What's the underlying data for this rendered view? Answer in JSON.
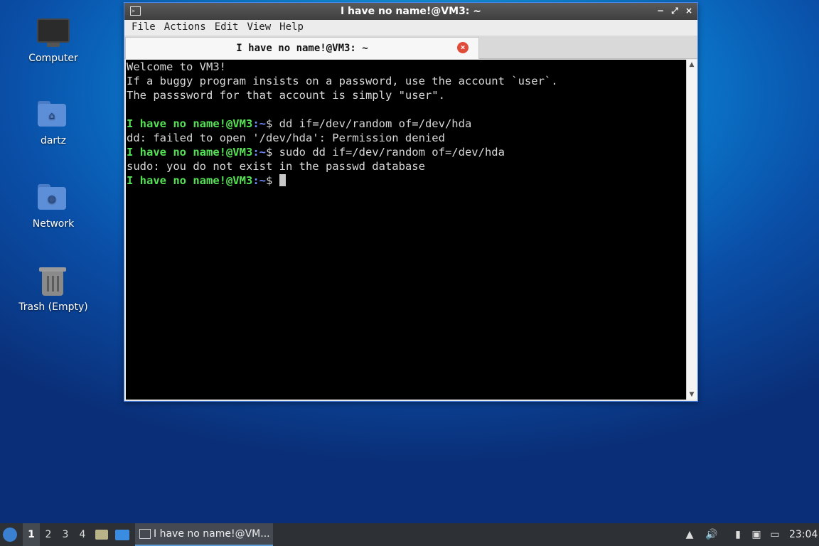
{
  "desktop": {
    "icons": [
      {
        "label": "Computer",
        "icon": "computer-icon"
      },
      {
        "label": "dartz",
        "icon": "home-folder-icon"
      },
      {
        "label": "Network",
        "icon": "network-folder-icon"
      },
      {
        "label": "Trash (Empty)",
        "icon": "trash-icon"
      }
    ]
  },
  "window": {
    "title": "I have no name!@VM3: ~",
    "controls": {
      "minimize": "−",
      "maximize": "⤢",
      "close": "×"
    },
    "menu": [
      "File",
      "Actions",
      "Edit",
      "View",
      "Help"
    ],
    "tab": {
      "label": "I have no name!@VM3: ~",
      "close": "×"
    }
  },
  "terminal": {
    "lines": [
      {
        "text": "Welcome to VM3!"
      },
      {
        "text": "If a buggy program insists on a password, use the account `user`."
      },
      {
        "text": "The passsword for that account is simply \"user\"."
      },
      {
        "text": ""
      },
      {
        "prompt_user": "I have no name!@VM3",
        "prompt_path": ":~",
        "prompt_sym": "$ ",
        "cmd": "dd if=/dev/random of=/dev/hda"
      },
      {
        "text": "dd: failed to open '/dev/hda': Permission denied"
      },
      {
        "prompt_user": "I have no name!@VM3",
        "prompt_path": ":~",
        "prompt_sym": "$ ",
        "cmd": "sudo dd if=/dev/random of=/dev/hda"
      },
      {
        "text": "sudo: you do not exist in the passwd database"
      },
      {
        "prompt_user": "I have no name!@VM3",
        "prompt_path": ":~",
        "prompt_sym": "$ ",
        "cmd": "",
        "cursor": true
      }
    ]
  },
  "taskbar": {
    "workspaces": [
      "1",
      "2",
      "3",
      "4"
    ],
    "active_workspace": "1",
    "task_label": "I have no name!@VM...",
    "clock": "23:04"
  }
}
